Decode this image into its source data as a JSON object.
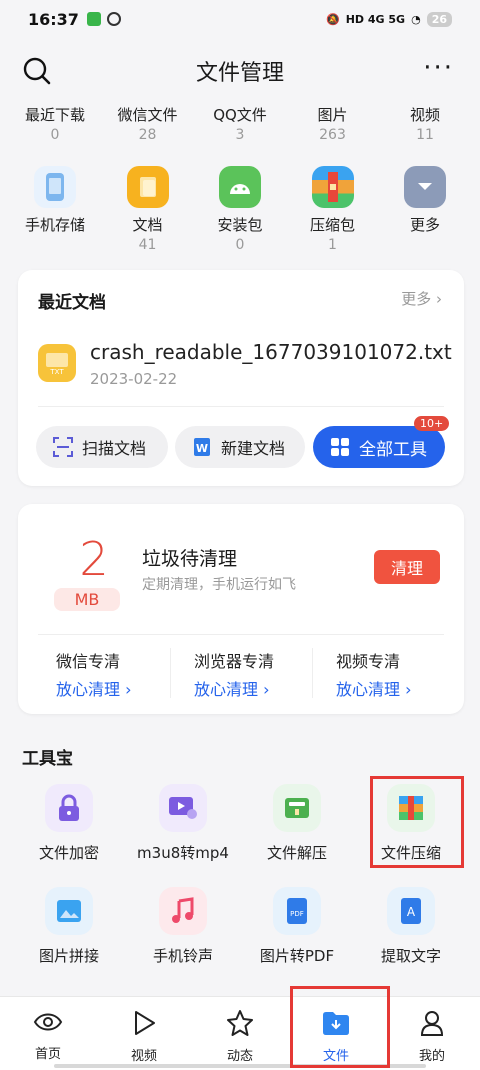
{
  "status": {
    "time": "16:37",
    "battery": "26",
    "net": "HD 4G 5G"
  },
  "header": {
    "title": "文件管理"
  },
  "quick": [
    {
      "label": "最近下载",
      "count": "0"
    },
    {
      "label": "微信文件",
      "count": "28"
    },
    {
      "label": "QQ文件",
      "count": "3"
    },
    {
      "label": "图片",
      "count": "263"
    },
    {
      "label": "视频",
      "count": "11"
    }
  ],
  "tiles": [
    {
      "label": "手机存储",
      "count": "",
      "color": "#7db6ee"
    },
    {
      "label": "文档",
      "count": "41",
      "color": "#f7b21f"
    },
    {
      "label": "安装包",
      "count": "0",
      "color": "#5bc35a"
    },
    {
      "label": "压缩包",
      "count": "1",
      "color": "#ee5a3a"
    },
    {
      "label": "更多",
      "count": "",
      "color": "#8c9bb8"
    }
  ],
  "recent": {
    "title": "最近文档",
    "more": "更多",
    "file_name": "crash_readable_1677039101072.txt",
    "file_date": "2023-02-22",
    "file_tag": "TXT",
    "btn_scan": "扫描文档",
    "btn_new": "新建文档",
    "btn_all": "全部工具",
    "badge": "10+"
  },
  "clean": {
    "size": "2",
    "unit": "MB",
    "title": "垃圾待清理",
    "subtitle": "定期清理，手机运行如飞",
    "button": "清理",
    "cols": [
      {
        "title": "微信专清",
        "action": "放心清理 ›"
      },
      {
        "title": "浏览器专清",
        "action": "放心清理 ›"
      },
      {
        "title": "视频专清",
        "action": "放心清理 ›"
      }
    ]
  },
  "tools": {
    "title": "工具宝",
    "items": [
      {
        "label": "文件加密",
        "color": "#f0eafc"
      },
      {
        "label": "m3u8转mp4",
        "color": "#f0eafc"
      },
      {
        "label": "文件解压",
        "color": "#e9f6ea"
      },
      {
        "label": "文件压缩",
        "color": "#e9f6ea"
      },
      {
        "label": "图片拼接",
        "color": "#e6f2fc"
      },
      {
        "label": "手机铃声",
        "color": "#fde9ec"
      },
      {
        "label": "图片转PDF",
        "color": "#e6f2fc"
      },
      {
        "label": "提取文字",
        "color": "#e6f2fc"
      }
    ]
  },
  "nav": [
    {
      "label": "首页"
    },
    {
      "label": "视频"
    },
    {
      "label": "动态"
    },
    {
      "label": "文件"
    },
    {
      "label": "我的"
    }
  ]
}
